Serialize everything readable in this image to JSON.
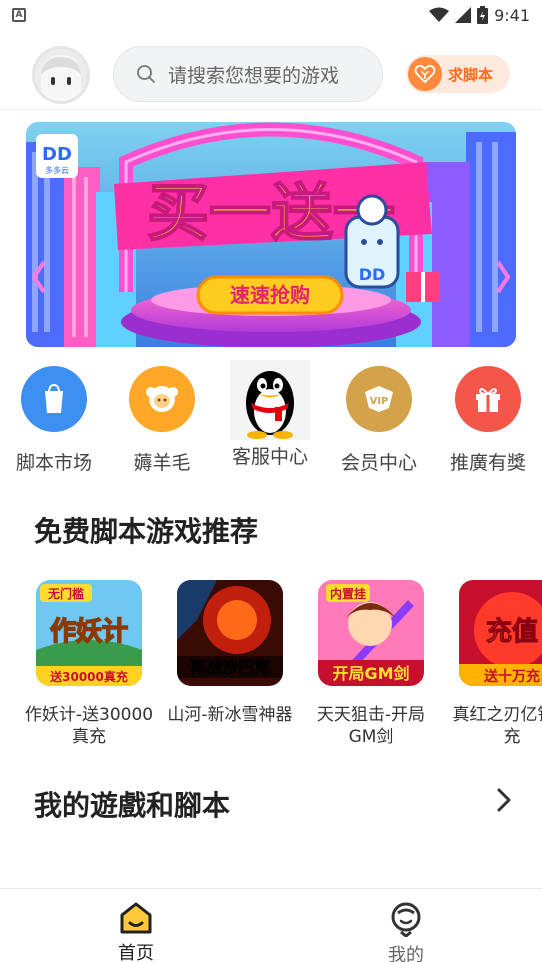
{
  "status_bar": {
    "time": "9:41"
  },
  "header": {
    "search_placeholder": "请搜索您想要的游戏",
    "request_script_label": "求脚本"
  },
  "banner": {
    "logo_text": "DD",
    "logo_sub": "多多云",
    "headline": "买一送一",
    "cta": "速速抢购"
  },
  "quick_actions": [
    {
      "label": "脚本市场",
      "icon": "shopping-bag-icon",
      "color": "#3d8ff2"
    },
    {
      "label": "薅羊毛",
      "icon": "sheep-icon",
      "color": "#ffa726"
    },
    {
      "label": "客服中心",
      "icon": "qq-penguin-icon",
      "color": "#000000"
    },
    {
      "label": "会员中心",
      "icon": "vip-icon",
      "color": "#d4a24a"
    },
    {
      "label": "推廣有獎",
      "icon": "gift-icon",
      "color": "#f4574a"
    }
  ],
  "sections": {
    "free_games_title": "免费脚本游戏推荐",
    "my_games_title": "我的遊戲和腳本"
  },
  "games": [
    {
      "name": "作妖计-送30000真充",
      "thumb_text_top": "无门槛",
      "thumb_text_main": "作妖计",
      "thumb_text_bottom": "送30000真充"
    },
    {
      "name": "山河-新冰雪神器",
      "thumb_text_main": "再战沙巴克"
    },
    {
      "name": "天天狙击-开局GM剑",
      "thumb_text_top": "内置挂",
      "thumb_text_main": "开局GM剑"
    },
    {
      "name": "真红之刃亿钻万充",
      "thumb_text_main": "充值",
      "thumb_text_bottom": "送十万充"
    }
  ],
  "bottom_nav": {
    "home_label": "首页",
    "me_label": "我的"
  }
}
